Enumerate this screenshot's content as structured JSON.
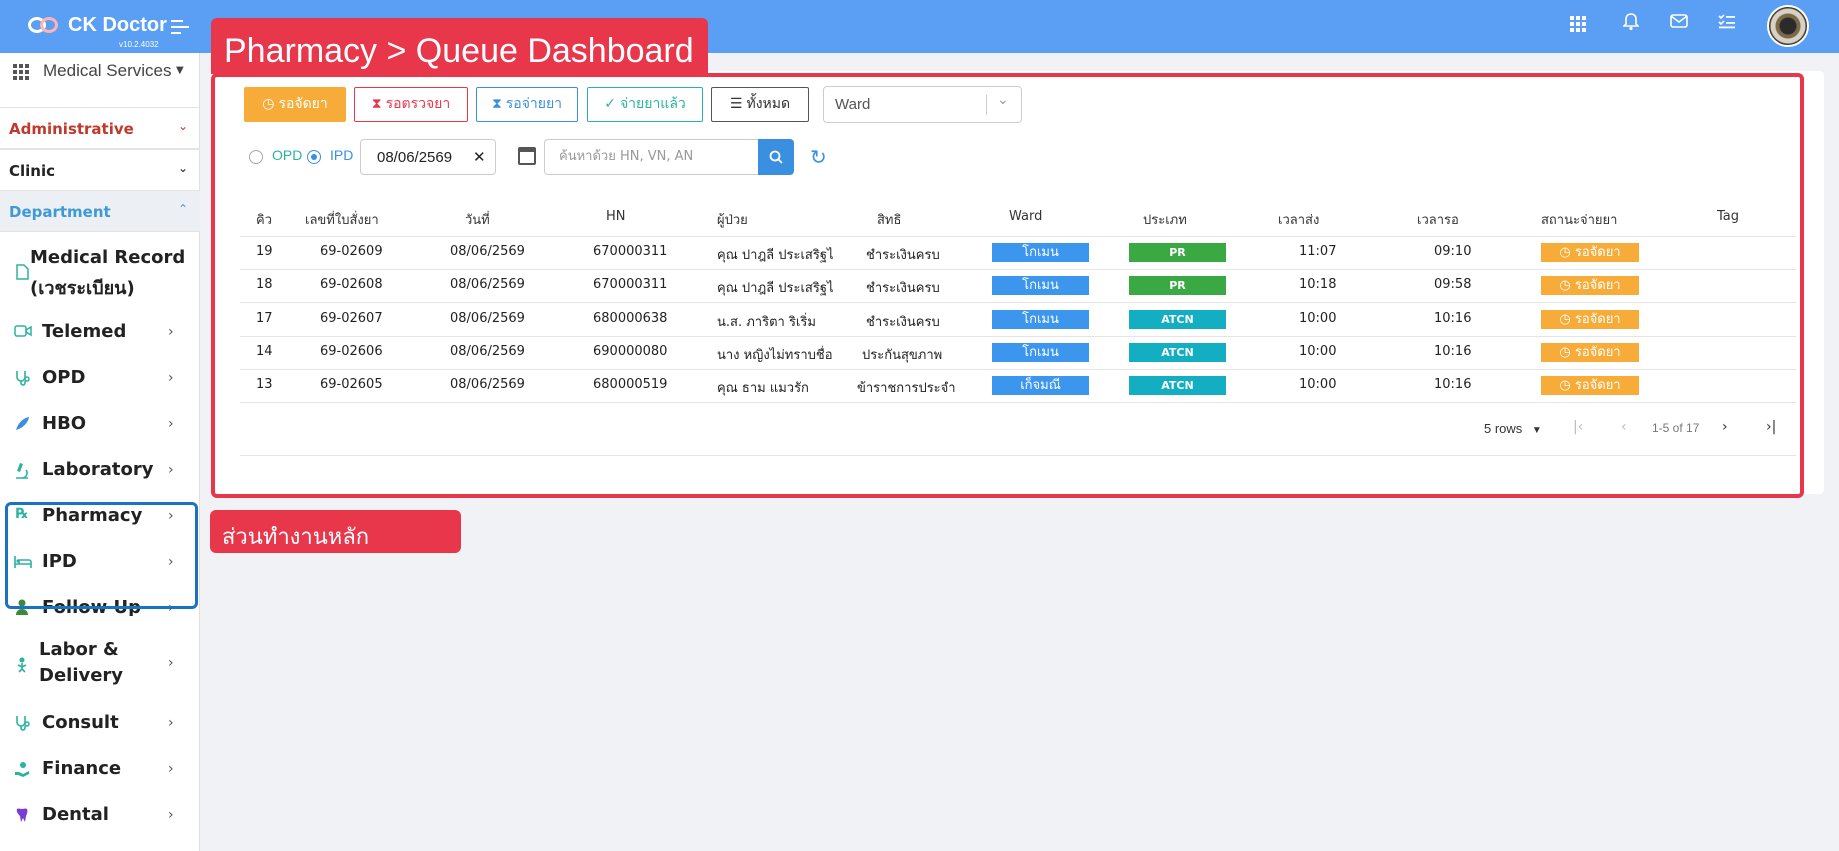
{
  "header": {
    "brand": "CK Doctor",
    "version": "v10.2.4032",
    "icons": [
      "apps-icon",
      "bell-icon",
      "mail-icon",
      "tasks-icon"
    ]
  },
  "sidebar": {
    "module": "Medical Services",
    "sections": {
      "administrative": "Administrative",
      "clinic": "Clinic",
      "department": "Department"
    },
    "items": [
      {
        "label": "Medical Record",
        "sub": "(เวชระเบียน)",
        "icon": "document-icon"
      },
      {
        "label": "Telemed",
        "icon": "video-icon"
      },
      {
        "label": "OPD",
        "icon": "stethoscope-icon"
      },
      {
        "label": "HBO",
        "icon": "feather-icon"
      },
      {
        "label": "Laboratory",
        "icon": "microscope-icon"
      },
      {
        "label": "Pharmacy",
        "icon": "rx-icon"
      },
      {
        "label": "IPD",
        "icon": "bed-icon"
      },
      {
        "label": "Follow Up",
        "icon": "user-icon"
      },
      {
        "label": "Labor &",
        "sub": "Delivery",
        "icon": "baby-icon"
      },
      {
        "label": "Consult",
        "icon": "stethoscope-icon"
      },
      {
        "label": "Finance",
        "icon": "hand-coin-icon"
      },
      {
        "label": "Dental",
        "icon": "tooth-icon"
      }
    ]
  },
  "annotations": {
    "title": "Pharmacy > Queue Dashboard",
    "bottom": "ส่วนทำงานหลัก"
  },
  "filters": {
    "buttons": [
      {
        "label": "รอจัดยา",
        "icon": "clock"
      },
      {
        "label": "รอตรวจยา",
        "icon": "hourglass"
      },
      {
        "label": "รอจ่ายยา",
        "icon": "hourglass"
      },
      {
        "label": "จ่ายยาแล้ว",
        "icon": "check"
      },
      {
        "label": "ทั้งหมด",
        "icon": "list"
      }
    ],
    "ward_placeholder": "Ward",
    "opd": "OPD",
    "ipd": "IPD",
    "selected_type": "IPD",
    "date": "08/06/2569",
    "search_placeholder": "ค้นหาด้วย HN, VN, AN"
  },
  "table": {
    "headers": [
      "คิว",
      "เลขที่ใบสั่งยา",
      "วันที่",
      "HN",
      "ผู้ป่วย",
      "สิทธิ",
      "Ward",
      "ประเภท",
      "เวลาส่ง",
      "เวลารอ",
      "สถานะจ่ายยา",
      "Tag"
    ],
    "rows": [
      {
        "q": "19",
        "rx": "69-02609",
        "date": "08/06/2569",
        "hn": "670000311",
        "patient": "คุณ ปาฎลี ประเสริฐไ",
        "right": "ชำระเงินครบ",
        "ward": "โกเมน",
        "type": "PR",
        "sent": "11:07",
        "wait": "09:10",
        "status": "รอจัดยา"
      },
      {
        "q": "18",
        "rx": "69-02608",
        "date": "08/06/2569",
        "hn": "670000311",
        "patient": "คุณ ปาฎลี ประเสริฐไ",
        "right": "ชำระเงินครบ",
        "ward": "โกเมน",
        "type": "PR",
        "sent": "10:18",
        "wait": "09:58",
        "status": "รอจัดยา"
      },
      {
        "q": "17",
        "rx": "69-02607",
        "date": "08/06/2569",
        "hn": "680000638",
        "patient": "น.ส. ภาริตา ริเริ่ม",
        "right": "ชำระเงินครบ",
        "ward": "โกเมน",
        "type": "ATCN",
        "sent": "10:00",
        "wait": "10:16",
        "status": "รอจัดยา"
      },
      {
        "q": "14",
        "rx": "69-02606",
        "date": "08/06/2569",
        "hn": "690000080",
        "patient": "นาง หญิงไม่ทราบชื่อ",
        "right": "ประกันสุขภาพ",
        "ward": "โกเมน",
        "type": "ATCN",
        "sent": "10:00",
        "wait": "10:16",
        "status": "รอจัดยา"
      },
      {
        "q": "13",
        "rx": "69-02605",
        "date": "08/06/2569",
        "hn": "680000519",
        "patient": "คุณ ธาม แมวรัก",
        "right": "ข้าราชการประจำ",
        "ward": "เก็จมณี",
        "type": "ATCN",
        "sent": "10:00",
        "wait": "10:16",
        "status": "รอจัดยา"
      }
    ]
  },
  "pagination": {
    "rows_label": "5 rows",
    "range": "1-5 of 17"
  },
  "colors": {
    "topbar": "#5b9ff5",
    "annotation_red": "#e8364b",
    "badge_blue": "#3d96ed",
    "badge_green": "#3aa843",
    "badge_teal": "#14aec2",
    "badge_orange": "#f7ac3a"
  }
}
